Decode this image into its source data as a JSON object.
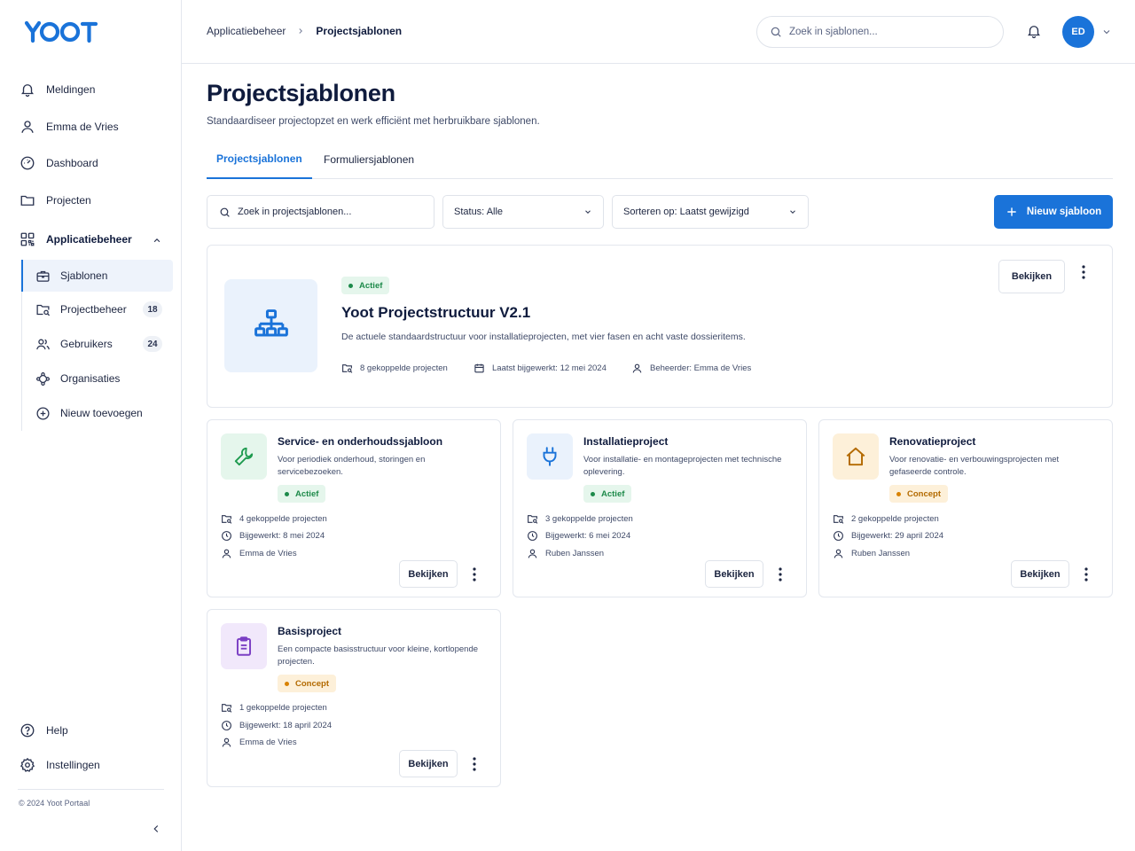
{
  "app": {
    "logo_text": "YOOT"
  },
  "sidebar": {
    "items": [
      {
        "label": "Meldingen",
        "icon": "bell-icon"
      },
      {
        "label": "Emma de Vries",
        "icon": "user-icon"
      },
      {
        "label": "Dashboard",
        "icon": "gauge-icon"
      },
      {
        "label": "Projecten",
        "icon": "folder-icon"
      },
      {
        "label": "Applicatiebeheer",
        "icon": "grid-icon"
      }
    ],
    "subitems": [
      {
        "label": "Sjablonen",
        "icon": "briefcase-icon"
      },
      {
        "label": "Projectbeheer",
        "icon": "folder-search-icon",
        "count": "18"
      },
      {
        "label": "Gebruikers",
        "icon": "users-icon",
        "count": "24"
      },
      {
        "label": "Organisaties",
        "icon": "network-icon"
      },
      {
        "label": "Nieuw toevoegen",
        "icon": "plus-circle-icon"
      }
    ],
    "bottom": [
      {
        "label": "Help",
        "icon": "help-icon"
      },
      {
        "label": "Instellingen",
        "icon": "gear-icon"
      }
    ],
    "copyright": "© 2024 Yoot Portaal"
  },
  "header": {
    "breadcrumb": [
      "Applicatiebeheer",
      "Projectsjablonen"
    ],
    "search_placeholder": "Zoek in sjablonen...",
    "avatar_initials": "ED"
  },
  "main": {
    "title": "Projectsjablonen",
    "subtitle": "Standaardiseer projectopzet en werk efficiënt met herbruikbare sjablonen.",
    "tabs": [
      {
        "label": "Projectsjablonen",
        "active": true
      },
      {
        "label": "Formuliersjablonen",
        "active": false
      }
    ],
    "filter_search_placeholder": "Zoek in projectsjablonen...",
    "status_filter": "Status: Alle",
    "sort_filter": "Sorteren op: Laatst gewijzigd",
    "new_button": "Nieuw sjabloon",
    "featured": {
      "status": "Actief",
      "title": "Yoot Projectstructuur V2.1",
      "description": "De actuele standaardstructuur voor installatieprojecten, met vier fasen en acht vaste dossieritems.",
      "projects": "8 gekoppelde projecten",
      "updated": "Laatst bijgewerkt: 12 mei 2024",
      "admin": "Beheerder: Emma de Vries",
      "view_label": "Bekijken"
    },
    "templates": [
      {
        "title": "Service- en onderhoudssjabloon",
        "description": "Voor periodiek onderhoud, storingen en servicebezoeken.",
        "status": "Actief",
        "projects": "4 gekoppelde projecten",
        "updated": "Bijgewerkt: 8 mei 2024",
        "owner": "Emma de Vries",
        "view_label": "Bekijken",
        "icon": "wrench-icon",
        "color": "#1d9a4e",
        "bg": "#e5f6ec"
      },
      {
        "title": "Installatieproject",
        "description": "Voor installatie- en montageprojecten met technische oplevering.",
        "status": "Actief",
        "projects": "3 gekoppelde projecten",
        "updated": "Bijgewerkt: 6 mei 2024",
        "owner": "Ruben Janssen",
        "view_label": "Bekijken",
        "icon": "plug-icon",
        "color": "#1a73d9",
        "bg": "#eaf2fc"
      },
      {
        "title": "Renovatieproject",
        "description": "Voor renovatie- en verbouwingsprojecten met gefaseerde controle.",
        "status": "Concept",
        "projects": "2 gekoppelde projecten",
        "updated": "Bijgewerkt: 29 april 2024",
        "owner": "Ruben Janssen",
        "view_label": "Bekijken",
        "icon": "house-icon",
        "color": "#b36a00",
        "bg": "#fdf0d9"
      },
      {
        "title": "Basisproject",
        "description": "Een compacte basisstructuur voor kleine, kortlopende projecten.",
        "status": "Concept",
        "projects": "1 gekoppelde projecten",
        "updated": "Bijgewerkt: 18 april 2024",
        "owner": "Emma de Vries",
        "view_label": "Bekijken",
        "icon": "clipboard-icon",
        "color": "#7b3fc4",
        "bg": "#f1e8fb"
      }
    ]
  }
}
